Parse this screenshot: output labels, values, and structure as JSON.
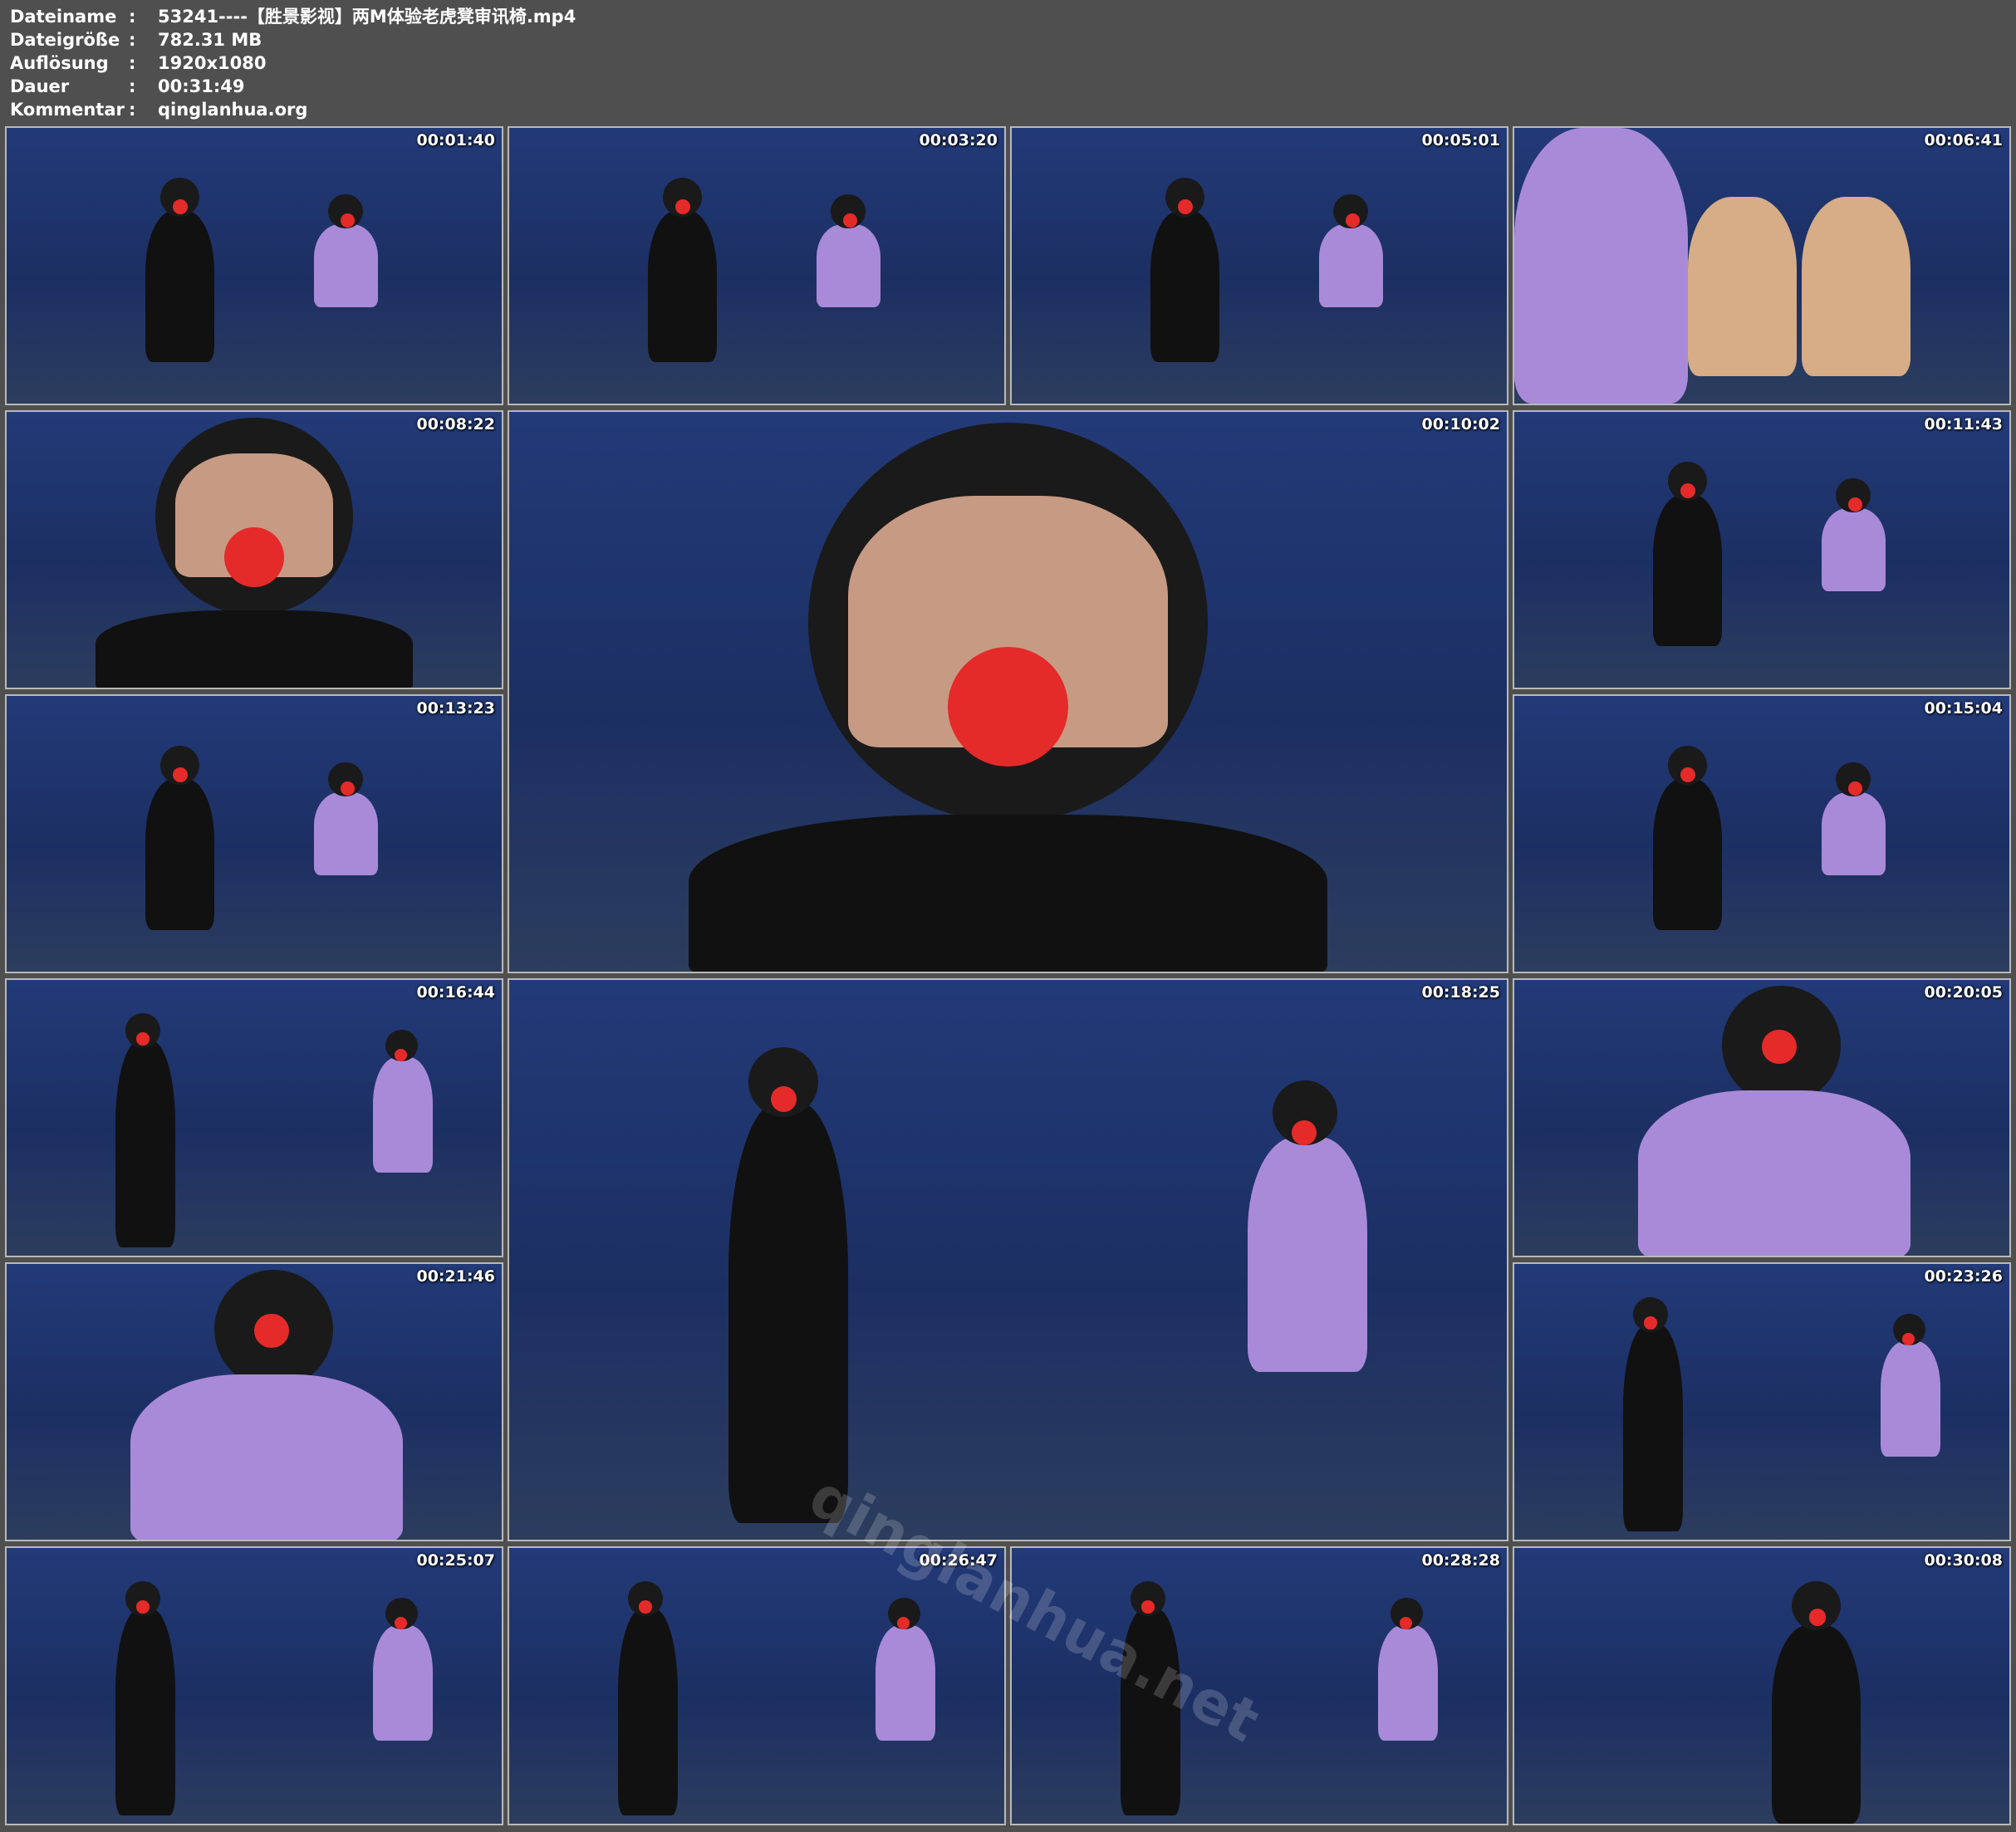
{
  "header": {
    "rows": [
      {
        "label": "Dateiname",
        "value": "53241----【胜景影视】两M体验老虎凳审讯椅.mp4"
      },
      {
        "label": "Dateigröße",
        "value": "782.31 MB"
      },
      {
        "label": "Auflösung",
        "value": "1920x1080"
      },
      {
        "label": "Dauer",
        "value": "00:31:49"
      },
      {
        "label": "Kommentar",
        "value": "qinglanhua.org"
      }
    ]
  },
  "thumbnails": [
    {
      "timestamp": "00:01:40",
      "scene": "wide"
    },
    {
      "timestamp": "00:03:20",
      "scene": "wide"
    },
    {
      "timestamp": "00:05:01",
      "scene": "wide"
    },
    {
      "timestamp": "00:06:41",
      "scene": "closeup-feet"
    },
    {
      "timestamp": "00:08:22",
      "scene": "closeup-face"
    },
    {
      "timestamp": "00:10:02",
      "scene": "closeup-face"
    },
    {
      "timestamp": "00:11:43",
      "scene": "wide"
    },
    {
      "timestamp": "00:13:23",
      "scene": "wide"
    },
    {
      "timestamp": "00:15:04",
      "scene": "wide"
    },
    {
      "timestamp": "00:16:44",
      "scene": "standing"
    },
    {
      "timestamp": "00:18:25",
      "scene": "standing"
    },
    {
      "timestamp": "00:20:05",
      "scene": "closeup-purple"
    },
    {
      "timestamp": "00:21:46",
      "scene": "closeup-purple"
    },
    {
      "timestamp": "00:23:26",
      "scene": "standing"
    },
    {
      "timestamp": "00:25:07",
      "scene": "standing"
    },
    {
      "timestamp": "00:26:47",
      "scene": "standing"
    },
    {
      "timestamp": "00:28:28",
      "scene": "standing"
    },
    {
      "timestamp": "00:30:08",
      "scene": "standing-single"
    }
  ],
  "watermark": "qinglanhua.net",
  "colors": {
    "background": "#4f4f4f",
    "border": "#b9b9b9",
    "scene": "#1b2a55",
    "dress_black": "#111111",
    "dress_purple": "#a98ad8",
    "gag": "#e52a2a"
  }
}
